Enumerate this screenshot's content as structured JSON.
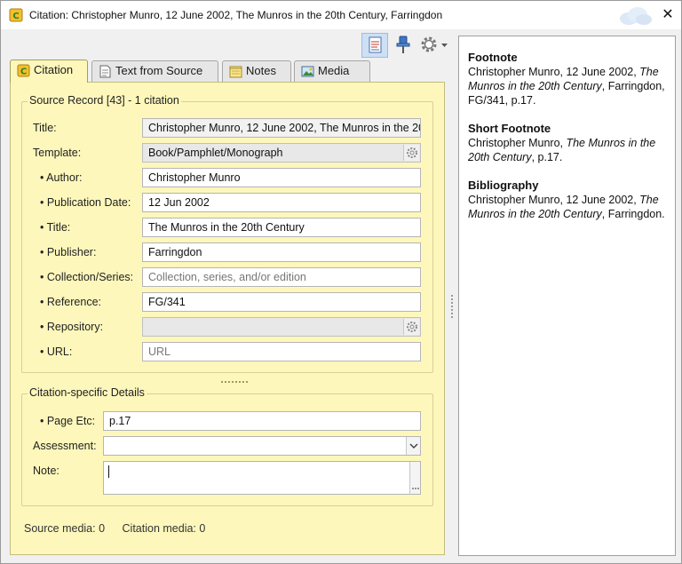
{
  "window": {
    "title": "Citation: Christopher Munro, 12 June 2002, The Munros in the 20th Century, Farringdon",
    "close_label": "✕"
  },
  "toolbar": {
    "sources_icon": "citation-document-icon",
    "pin_icon": "pin-icon",
    "settings_icon": "gear-icon"
  },
  "tabs": [
    {
      "label": "Citation",
      "icon": "citation-icon",
      "selected": true
    },
    {
      "label": "Text from Source",
      "icon": "document-icon",
      "selected": false
    },
    {
      "label": "Notes",
      "icon": "notes-icon",
      "selected": false
    },
    {
      "label": "Media",
      "icon": "image-icon",
      "selected": false
    }
  ],
  "source_record": {
    "group_label": "Source Record [43] - 1 citation",
    "fields": {
      "title": {
        "label": "Title:",
        "value": "Christopher Munro, 12 June 2002, The Munros in the 20th Century, Farringdon"
      },
      "template": {
        "label": "Template:",
        "value": "Book/Pamphlet/Monograph"
      },
      "author": {
        "label": "• Author:",
        "value": "Christopher Munro"
      },
      "publication_date": {
        "label": "• Publication Date:",
        "value": "12 Jun 2002"
      },
      "book_title": {
        "label": "• Title:",
        "value": "The Munros in the 20th Century"
      },
      "publisher": {
        "label": "• Publisher:",
        "value": "Farringdon"
      },
      "collection": {
        "label": "• Collection/Series:",
        "value": "",
        "placeholder": "Collection, series, and/or edition"
      },
      "reference": {
        "label": "• Reference:",
        "value": "FG/341"
      },
      "repository": {
        "label": "• Repository:",
        "value": ""
      },
      "url": {
        "label": "• URL:",
        "value": "",
        "placeholder": "URL"
      }
    }
  },
  "citation_details": {
    "group_label": "Citation-specific Details",
    "page_etc": {
      "label": "• Page Etc:",
      "value": "p.17"
    },
    "assessment": {
      "label": "Assessment:",
      "value": ""
    },
    "note": {
      "label": "Note:",
      "value": ""
    }
  },
  "status": {
    "source_media": "Source media: 0",
    "citation_media": "Citation media: 0"
  },
  "preview": {
    "footnote": {
      "heading": "Footnote",
      "pre": "Christopher Munro, 12 June 2002, ",
      "italic": "The Munros in the 20th Century",
      "post": ", Farringdon, FG/341, p.17."
    },
    "short_footnote": {
      "heading": "Short Footnote",
      "pre": "Christopher Munro, ",
      "italic": "The Munros in the 20th Century",
      "post": ", p.17."
    },
    "bibliography": {
      "heading": "Bibliography",
      "pre": "Christopher Munro, 12 June 2002, ",
      "italic": "The Munros in the 20th Century",
      "post": ", Farringdon."
    }
  },
  "colors": {
    "panel_bg": "#fdf7bb",
    "toolbar_active": "#cde0f4"
  }
}
